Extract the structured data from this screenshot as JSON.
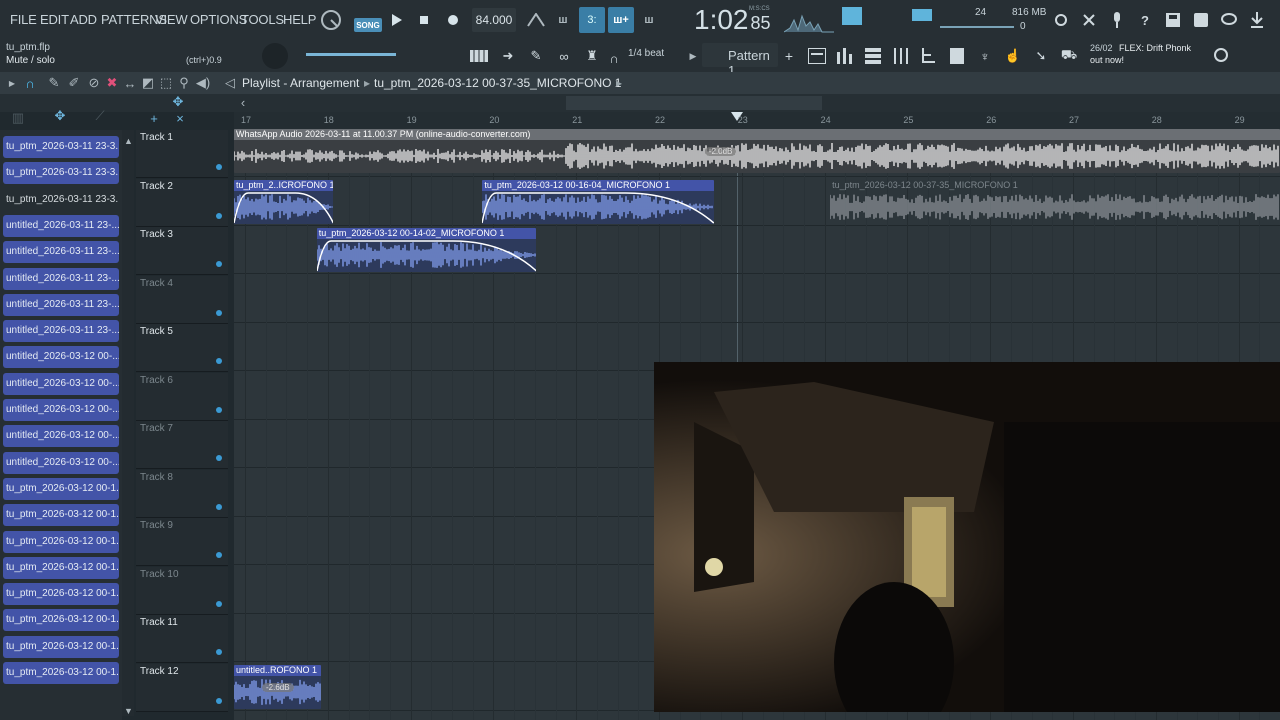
{
  "menu": [
    "FILE",
    "EDIT",
    "ADD",
    "PATTERNS",
    "VIEW",
    "OPTIONS",
    "TOOLS",
    "HELP"
  ],
  "transport": {
    "song_label": "SONG",
    "tempo": "84.000",
    "time": "1:02",
    "time_sub": "85",
    "time_units": "M:S:CS",
    "cpu_label": "24",
    "ram": "816 MB",
    "ram_sub": "0"
  },
  "project": {
    "file": "tu_ptm.flp",
    "hint": "Mute / solo",
    "shortcut": "(ctrl+)0.9"
  },
  "snap": "1/4 beat",
  "pattern": "Pattern 1",
  "news": {
    "date": "26/02",
    "text": "FLEX: Drift Phonk",
    "sub": "out now!"
  },
  "playlist": {
    "title": "Playlist - Arrangement",
    "clip_name": "tu_ptm_2026-03-12 00-37-35_MICROFONO 1"
  },
  "ruler": [
    "17",
    "18",
    "19",
    "20",
    "21",
    "22",
    "23",
    "24",
    "25",
    "26",
    "27",
    "28",
    "29"
  ],
  "picker": [
    {
      "label": "tu_ptm_2026-03-11 23-3...",
      "style": "blue"
    },
    {
      "label": "tu_ptm_2026-03-11 23-3...",
      "style": "blue"
    },
    {
      "label": "tu_ptm_2026-03-11 23-3...",
      "style": "plain"
    },
    {
      "label": "untitled_2026-03-11 23-...",
      "style": "blue"
    },
    {
      "label": "untitled_2026-03-11 23-...",
      "style": "blue"
    },
    {
      "label": "untitled_2026-03-11 23-...",
      "style": "blue"
    },
    {
      "label": "untitled_2026-03-11 23-...",
      "style": "blue"
    },
    {
      "label": "untitled_2026-03-11 23-...",
      "style": "blue"
    },
    {
      "label": "untitled_2026-03-12 00-...",
      "style": "blue"
    },
    {
      "label": "untitled_2026-03-12 00-...",
      "style": "blue"
    },
    {
      "label": "untitled_2026-03-12 00-...",
      "style": "blue"
    },
    {
      "label": "untitled_2026-03-12 00-...",
      "style": "blue"
    },
    {
      "label": "untitled_2026-03-12 00-...",
      "style": "blue"
    },
    {
      "label": "tu_ptm_2026-03-12 00-1...",
      "style": "blue"
    },
    {
      "label": "tu_ptm_2026-03-12 00-1...",
      "style": "blue"
    },
    {
      "label": "tu_ptm_2026-03-12 00-1...",
      "style": "blue"
    },
    {
      "label": "tu_ptm_2026-03-12 00-1...",
      "style": "blue"
    },
    {
      "label": "tu_ptm_2026-03-12 00-1...",
      "style": "blue"
    },
    {
      "label": "tu_ptm_2026-03-12 00-1...",
      "style": "blue"
    },
    {
      "label": "tu_ptm_2026-03-12 00-1...",
      "style": "blue"
    },
    {
      "label": "tu_ptm_2026-03-12 00-1...",
      "style": "blue"
    }
  ],
  "tracks": [
    {
      "name": "Track 1",
      "dim": false
    },
    {
      "name": "Track 2",
      "dim": false
    },
    {
      "name": "Track 3",
      "dim": false
    },
    {
      "name": "Track 4",
      "dim": true
    },
    {
      "name": "Track 5",
      "dim": false
    },
    {
      "name": "Track 6",
      "dim": true
    },
    {
      "name": "Track 7",
      "dim": true
    },
    {
      "name": "Track 8",
      "dim": true
    },
    {
      "name": "Track 9",
      "dim": true
    },
    {
      "name": "Track 10",
      "dim": true
    },
    {
      "name": "Track 11",
      "dim": false
    },
    {
      "name": "Track 12",
      "dim": false
    }
  ],
  "clips": [
    {
      "track": 0,
      "start": 17,
      "end": 30,
      "label": "WhatsApp Audio 2026-03-11 at 11.00.37 PM (online-audio-converter.com)",
      "color": "#6b6f74",
      "wave": "#e8e8e8",
      "vol": "-2.0dB"
    },
    {
      "track": 1,
      "start": 17,
      "end": 18.2,
      "label": "tu_ptm_2..ICROFONO 1",
      "color": "#4354a8",
      "wave": "#7f9ae8",
      "fade": true
    },
    {
      "track": 1,
      "start": 20,
      "end": 22.8,
      "label": "tu_ptm_2026-03-12 00-16-04_MICROFONO 1",
      "color": "#4354a8",
      "wave": "#7f9ae8",
      "fade": true
    },
    {
      "track": 1,
      "start": 24.2,
      "end": 30,
      "label": "tu_ptm_2026-03-12 00-37-35_MICROFONO 1",
      "color": "#3b4147",
      "wave": "#8a9096",
      "muted": true
    },
    {
      "track": 2,
      "start": 18,
      "end": 20.65,
      "label": "tu_ptm_2026-03-12 00-14-02_MICROFONO 1",
      "color": "#4354a8",
      "wave": "#7f9ae8",
      "fade": true
    },
    {
      "track": 11,
      "start": 17,
      "end": 18.05,
      "label": "untitled..ROFONO 1",
      "color": "#4354a8",
      "wave": "#7f9ae8",
      "vol": "-2.6dB"
    }
  ],
  "colors": {
    "accent": "#4fc3f7",
    "clip_blue": "#4354a8"
  }
}
